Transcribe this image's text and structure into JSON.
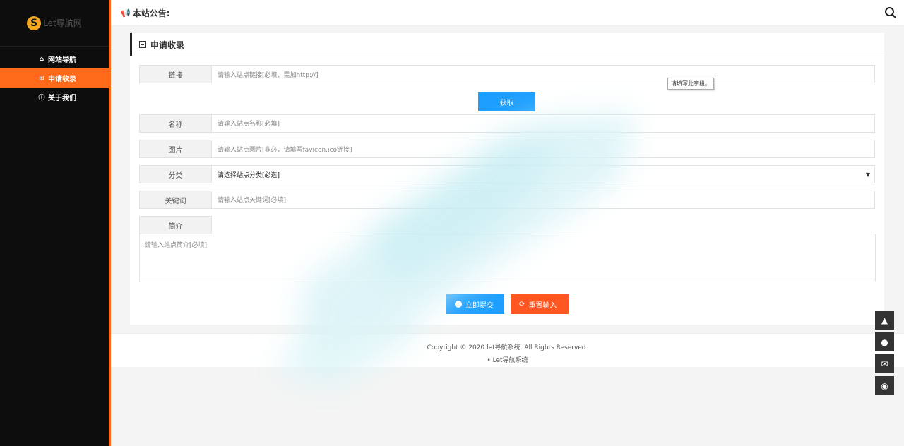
{
  "sidebar": {
    "logo_mark": "S",
    "logo_text": "Let导航网",
    "items": [
      {
        "icon": "home-icon",
        "label": "网站导航",
        "active": false
      },
      {
        "icon": "plus-square-icon",
        "label": "申请收录",
        "active": true
      },
      {
        "icon": "info-icon",
        "label": "关于我们",
        "active": false
      }
    ]
  },
  "topbar": {
    "notice_label": "本站公告:"
  },
  "form": {
    "title": "申请收录",
    "fields": {
      "link": {
        "label": "链接",
        "placeholder": "请输入站点链接[必填，需加http://]"
      },
      "fetch_button": "获取",
      "name": {
        "label": "名称",
        "placeholder": "请输入站点名称[必填]"
      },
      "image": {
        "label": "图片",
        "placeholder": "请输入站点图片[非必，请填写favicon.ico链接]"
      },
      "category": {
        "label": "分类",
        "selected": "请选择站点分类[必选]"
      },
      "keywords": {
        "label": "关键词",
        "placeholder": "请输入站点关键词[必填]"
      },
      "intro": {
        "label": "简介",
        "placeholder": "请输入站点简介[必填]"
      }
    },
    "tooltip": "请填写此字段。",
    "submit_label": "立即提交",
    "reset_label": "重置输入"
  },
  "footer": {
    "copyright": "Copyright © 2020 let导航系统. All Rights Reserved.",
    "link_label": "Let导航系统"
  },
  "floatbar": [
    "arrow-up-icon",
    "qq-icon",
    "mail-icon",
    "wechat-icon"
  ],
  "colors": {
    "accent": "#ff6a1a",
    "primary": "#1e9fff",
    "reset": "#ff5722",
    "sidebar_bg": "#0d0d0d"
  }
}
